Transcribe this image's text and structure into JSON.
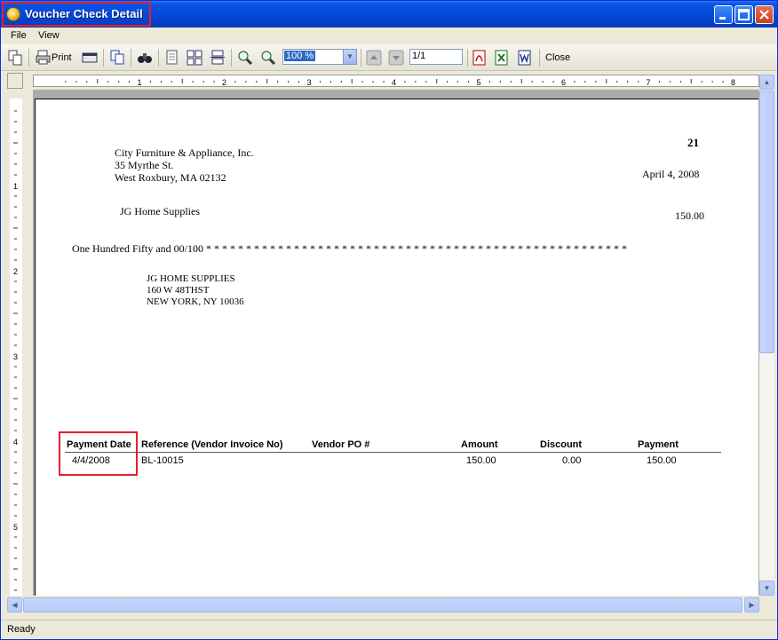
{
  "window": {
    "title": "Voucher Check Detail"
  },
  "menu": {
    "file": "File",
    "view": "View"
  },
  "toolbar": {
    "print_label": "Print",
    "zoom": "100 %",
    "page": "1/1",
    "close_label": "Close"
  },
  "check": {
    "number": "21",
    "company_name": "City Furniture & Appliance, Inc.",
    "company_address1": "35 Myrthe St.",
    "company_address2": "West Roxbury, MA 02132",
    "date": "April 4, 2008",
    "payee": "JG Home Supplies",
    "amount": "150.00",
    "amount_words": "One Hundred Fifty and 00/100 * * * * * * * * * * * * * * * * * * * * * * * * * * * * * * * * * * * * * * * * * * * * * * * * * * * * *",
    "mail_name": "JG HOME SUPPLIES",
    "mail_address1": "160 W 48THST",
    "mail_address2": "NEW YORK, NY 10036"
  },
  "table": {
    "headers": {
      "payment_date": "Payment Date",
      "reference": "Reference (Vendor Invoice No)",
      "vendor_po": "Vendor PO #",
      "amount": "Amount",
      "discount": "Discount",
      "payment": "Payment"
    },
    "rows": [
      {
        "payment_date": "4/4/2008",
        "reference": "BL-10015",
        "vendor_po": "",
        "amount": "150.00",
        "discount": "0.00",
        "payment": "150.00"
      }
    ]
  },
  "ruler": {
    "h_labels": [
      "1",
      "2",
      "3",
      "4",
      "5",
      "6",
      "7",
      "8"
    ],
    "v_labels": [
      "1",
      "2",
      "3",
      "4",
      "5"
    ]
  },
  "status": {
    "text": "Ready"
  },
  "colors": {
    "title_bar": "#0A54E4",
    "highlight": "#e0202a",
    "selection": "#316AC5"
  }
}
